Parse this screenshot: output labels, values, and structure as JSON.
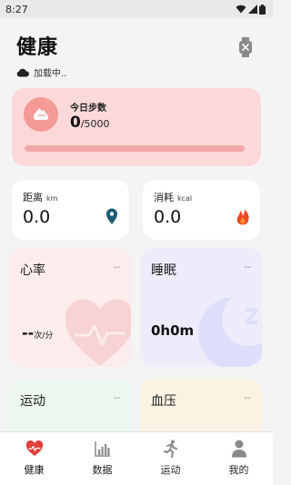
{
  "status_bar": {
    "time": "8:27",
    "icons": [
      "wifi-icon",
      "cellular-signal-icon",
      "battery-icon"
    ]
  },
  "header": {
    "title": "健康",
    "sync_text": "加载中..",
    "sync_icon": "cloud-icon",
    "watch_icon": "watch-off-icon"
  },
  "steps": {
    "label": "今日步数",
    "value": "0",
    "goal": "/5000",
    "progress": 0,
    "icon": "shoe-icon",
    "colors": {
      "card": "#fcd9d9",
      "accent": "#ea6b66"
    }
  },
  "metrics": {
    "distance": {
      "label": "距离",
      "unit": "km",
      "value": "0.0",
      "icon": "location-pin-icon",
      "icon_color": "#1d5a73"
    },
    "calories": {
      "label": "消耗",
      "unit": "kcal",
      "value": "0.0",
      "icon": "flame-icon",
      "icon_color": "#f04a22"
    }
  },
  "tiles": {
    "heart_rate": {
      "title": "心率",
      "dash": "--",
      "value": "--",
      "unit": "次/分",
      "icon": "heart-pulse-icon"
    },
    "sleep": {
      "title": "睡眠",
      "dash": "--",
      "value": "0h0m",
      "icon": "moon-zzz-icon"
    },
    "exercise": {
      "title": "运动",
      "dash": "--"
    },
    "blood_pressure": {
      "title": "血压",
      "dash": "--"
    }
  },
  "tab_bar": {
    "items": [
      {
        "label": "健康",
        "icon": "heart-icon",
        "active": true
      },
      {
        "label": "数据",
        "icon": "bar-chart-icon",
        "active": false
      },
      {
        "label": "运动",
        "icon": "running-icon",
        "active": false
      },
      {
        "label": "我的",
        "icon": "user-icon",
        "active": false
      }
    ],
    "active_color": "#e2403b"
  }
}
